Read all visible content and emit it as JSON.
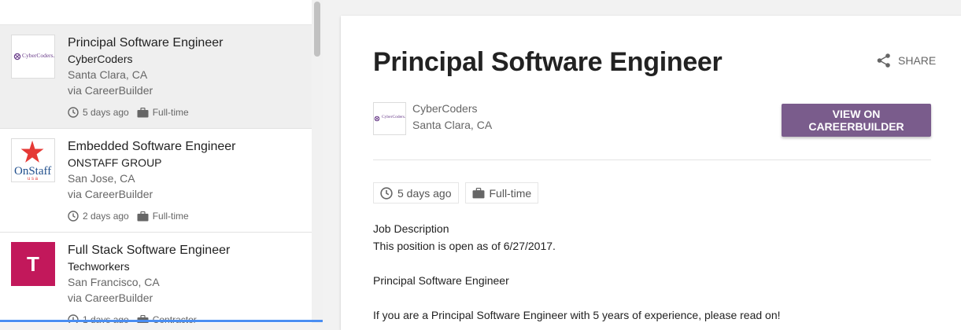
{
  "jobs": [
    {
      "title": "Principal Software Engineer",
      "company": "CyberCoders",
      "location": "Santa Clara, CA",
      "via": "via CareerBuilder",
      "posted": "5 days ago",
      "type": "Full-time",
      "logo_text": "CyberCoders."
    },
    {
      "title": "Embedded Software Engineer",
      "company": "ONSTAFF GROUP",
      "location": "San Jose, CA",
      "via": "via CareerBuilder",
      "posted": "2 days ago",
      "type": "Full-time",
      "logo_text": "OnStaff",
      "logo_sub": "u s a"
    },
    {
      "title": "Full Stack Software Engineer",
      "company": "Techworkers",
      "location": "San Francisco, CA",
      "via": "via CareerBuilder",
      "posted": "1 days ago",
      "type": "Contractor",
      "logo_text": "T"
    }
  ],
  "detail": {
    "title": "Principal Software Engineer",
    "share_label": "SHARE",
    "company": "CyberCoders",
    "location": "Santa Clara, CA",
    "logo_text": "CyberCoders.",
    "apply_label": "VIEW ON CAREERBUILDER",
    "posted": "5 days ago",
    "type": "Full-time",
    "description": [
      "Job Description",
      "This position is open as of 6/27/2017.",
      "",
      "Principal Software Engineer",
      "",
      "If you are a Principal Software Engineer with 5 years of experience, please read on!"
    ]
  },
  "colors": {
    "apply_button": "#7a5c8c",
    "selected_row": "#efefef",
    "techworkers_logo": "#c2185b",
    "onstaff_star": "#e53935",
    "onstaff_text": "#1f4e8c",
    "cybercoders_text": "#6a3d8a"
  },
  "icons": {
    "clock": "clock-icon",
    "briefcase": "briefcase-icon",
    "share": "share-icon"
  }
}
